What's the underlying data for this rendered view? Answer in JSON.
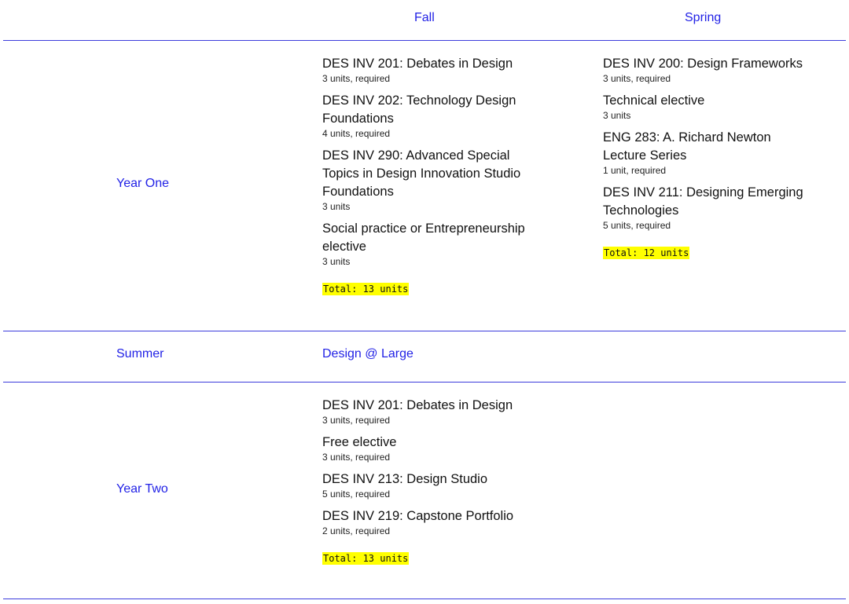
{
  "header": {
    "fall": "Fall",
    "spring": "Spring"
  },
  "year_one": {
    "label": "Year One",
    "fall": [
      {
        "title": "DES INV 201: Debates in Design",
        "units": "3 units, required"
      },
      {
        "title": "DES INV 202: Technology Design Foundations",
        "units": "4 units, required"
      },
      {
        "title": "DES INV 290: Advanced Special Topics in Design Innovation Studio Foundations",
        "units": "3 units"
      },
      {
        "title": "Social practice or Entrepreneurship elective",
        "units": "3 units"
      }
    ],
    "fall_total": "Total: 13 units",
    "spring": [
      {
        "title": "DES INV 200: Design Frameworks",
        "units": "3 units, required"
      },
      {
        "title": "Technical elective",
        "units": "3 units"
      },
      {
        "title": "ENG 283: A. Richard Newton Lecture Series",
        "units": "1 unit, required"
      },
      {
        "title": "DES INV 211: Designing Emerging Technologies",
        "units": "5 units, required"
      }
    ],
    "spring_total": "Total: 12 units"
  },
  "summer": {
    "label": "Summer",
    "link": "Design @ Large"
  },
  "year_two": {
    "label": "Year Two",
    "fall": [
      {
        "title": "DES INV 201: Debates in Design",
        "units": "3 units, required"
      },
      {
        "title": "Free elective",
        "units": "3 units, required"
      },
      {
        "title": "DES INV 213: Design Studio",
        "units": "5 units, required"
      },
      {
        "title": "DES INV 219: Capstone Portfolio",
        "units": "2 units, required"
      }
    ],
    "fall_total": "Total: 13 units"
  },
  "colors": {
    "accent": "#2222e6",
    "highlight": "#ffff00",
    "rule": "#3c3cdc"
  }
}
